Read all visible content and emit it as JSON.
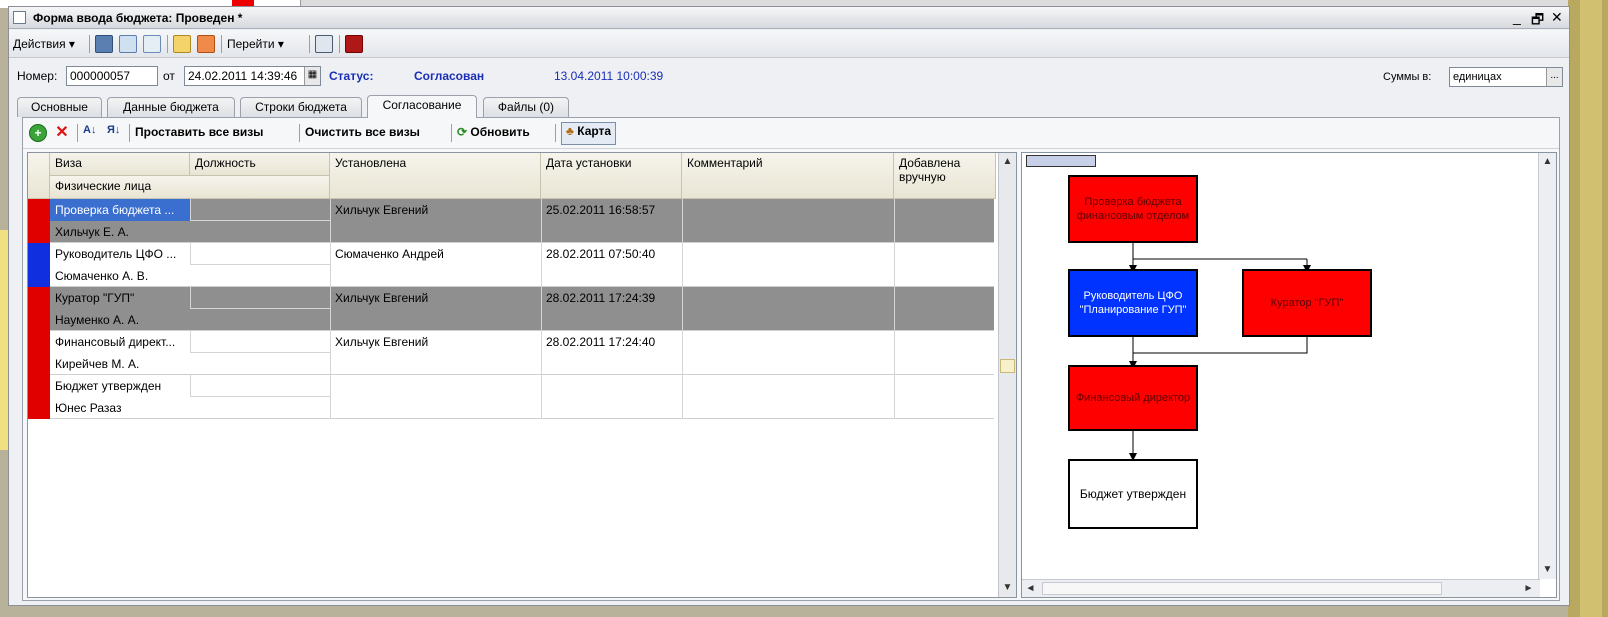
{
  "window": {
    "title": "Форма ввода бюджета: Проведен *",
    "controls": [
      "_",
      "🗗",
      "✕"
    ]
  },
  "toolbar": {
    "actions_label": "Действия",
    "goto_label": "Перейти"
  },
  "header": {
    "number_label": "Номер:",
    "number_value": "000000057",
    "from_label": "от",
    "date_value": "24.02.2011 14:39:46",
    "status_label": "Статус:",
    "status_value": "Согласован",
    "status_date": "13.04.2011 10:00:39",
    "sums_label": "Суммы в:",
    "sums_value": "единицах"
  },
  "tabs": [
    {
      "label": "Основные"
    },
    {
      "label": "Данные бюджета"
    },
    {
      "label": "Строки бюджета"
    },
    {
      "label": "Согласование",
      "active": true
    },
    {
      "label": "Файлы (0)"
    }
  ],
  "panel_toolbar": {
    "set_all": "Проставить все визы",
    "clear_all": "Очистить все визы",
    "refresh": "Обновить",
    "map": "Карта"
  },
  "grid": {
    "columns": [
      "Виза",
      "Должность",
      "Установлена",
      "Дата установки",
      "Комментарий",
      "Добавлена вручную"
    ],
    "subheader": "Физические лица",
    "rows": [
      {
        "visa": "Проверка бюджета ...",
        "person": "Хильчук Е. А.",
        "set_by": "Хильчук Евгений",
        "date": "25.02.2011 16:58:57",
        "marker": "#e00000",
        "shade": "#8f8f8f",
        "selected": true
      },
      {
        "visa": "Руководитель ЦФО ...",
        "person": "Сюмаченко А. В.",
        "set_by": "Сюмаченко Андрей",
        "date": "28.02.2011 07:50:40",
        "marker": "#1030e0",
        "shade": "#ffffff"
      },
      {
        "visa": "Куратор \"ГУП\"",
        "person": "Науменко А. А.",
        "set_by": "Хильчук Евгений",
        "date": "28.02.2011 17:24:39",
        "marker": "#e00000",
        "shade": "#8f8f8f"
      },
      {
        "visa": "Финансовый директ...",
        "person": "Кирейчев М. А.",
        "set_by": "Хильчук Евгений",
        "date": "28.02.2011 17:24:40",
        "marker": "#e00000",
        "shade": "#ffffff"
      },
      {
        "visa": "Бюджет утвержден",
        "person": "Юнес Разаз",
        "set_by": "",
        "date": "",
        "marker": "#e00000",
        "shade": "#ffffff"
      }
    ]
  },
  "map": {
    "nodes": [
      {
        "id": "check",
        "label": "Проверка бюджета финансовым отделом",
        "color": "#ff0000"
      },
      {
        "id": "cfo",
        "label": "Руководитель ЦФО \"Планирование ГУП\"",
        "color": "#0033ff"
      },
      {
        "id": "curator",
        "label": "Куратор \"ГУП\"",
        "color": "#ff0000"
      },
      {
        "id": "findir",
        "label": "Финансовый директор",
        "color": "#ff0000"
      },
      {
        "id": "approved",
        "label": "Бюджет утвержден",
        "color": "#ffffff"
      }
    ]
  }
}
